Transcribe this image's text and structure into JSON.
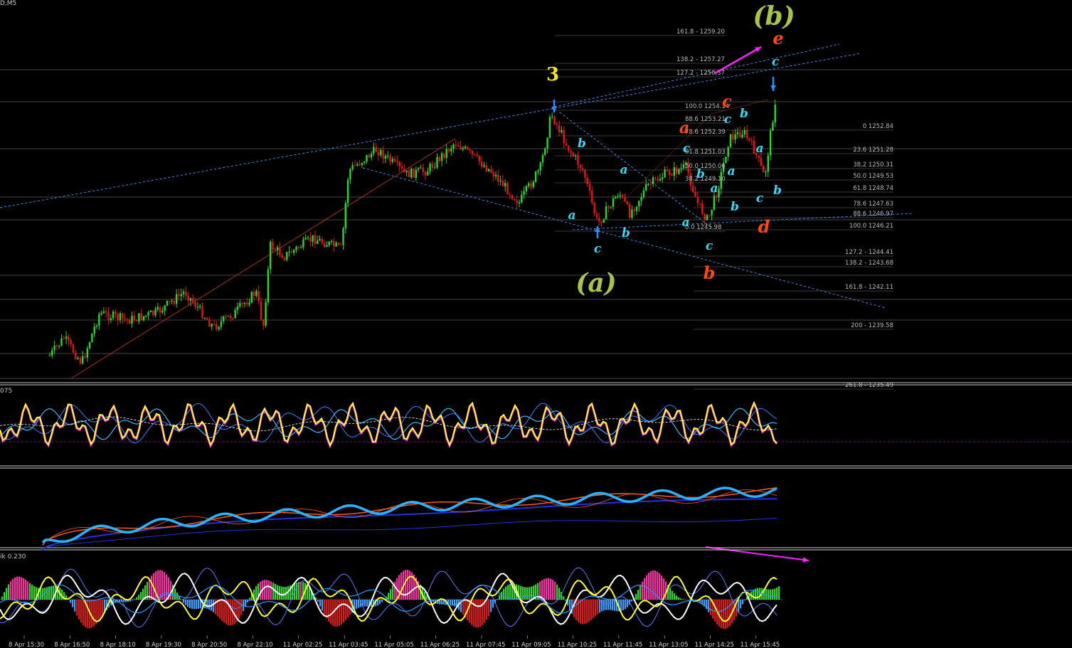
{
  "window": {
    "symbol_label": "D,M5"
  },
  "colors": {
    "background": "#000000",
    "bull": "#22dd22",
    "bear": "#ee1111",
    "level_line": "#b8b8b8",
    "trend_dotted": "#3b8fe8",
    "wave_orange": "#ff4a0a",
    "wave_cyan": "#33d9f7",
    "wave_yellow": "#f5e61a",
    "wave_green": "#a7c447",
    "magenta": "#ff22ff",
    "oscillator_yellow": "#ffff22",
    "oscillator_blue": "#1aa7ff",
    "navy": "#2233dd"
  },
  "main_panel": {
    "fib_levels_upper": [
      "161.8 - 1259.20",
      "138.2 - 1257.27",
      "127.2 - 1256.37",
      "100.0 1254.14",
      "88.6 1253.21",
      "78.6 1252.39",
      "61.8 1251.03",
      "50.0 1250.06",
      "38.2 1249.10",
      "0.0 1245.98"
    ],
    "fib_levels_right": [
      "0 1252.84",
      "23.6 1251.28",
      "38.2 1250.31",
      "50.0 1249.53",
      "61.8 1248.74",
      "78.6 1247.63",
      "88.6 1246.97",
      "100.0 1246.21",
      "127.2 - 1244.41",
      "138.2 - 1243.68",
      "161.8 - 1242.11",
      "200 - 1239.58",
      "261.8 - 1235.49"
    ],
    "wave_labels": {
      "big_b": "(b)",
      "big_a": "(a)",
      "three": "3",
      "e": "e",
      "c": "c",
      "a": "a",
      "b": "b",
      "d": "d"
    }
  },
  "indicator1": {
    "label": "075"
  },
  "indicator3": {
    "label": "ik 0.230"
  },
  "time_axis": [
    "8 Apr 15:30",
    "8 Apr 16:50",
    "8 Apr 18:10",
    "8 Apr 19:30",
    "8 Apr 20:50",
    "8 Apr 22:10",
    "11 Apr 02:25",
    "11 Apr 03:45",
    "11 Apr 05:05",
    "11 Apr 06:25",
    "11 Apr 07:45",
    "11 Apr 09:05",
    "11 Apr 10:25",
    "11 Apr 11:45",
    "11 Apr 13:05",
    "11 Apr 14:25",
    "11 Apr 15:45"
  ]
}
